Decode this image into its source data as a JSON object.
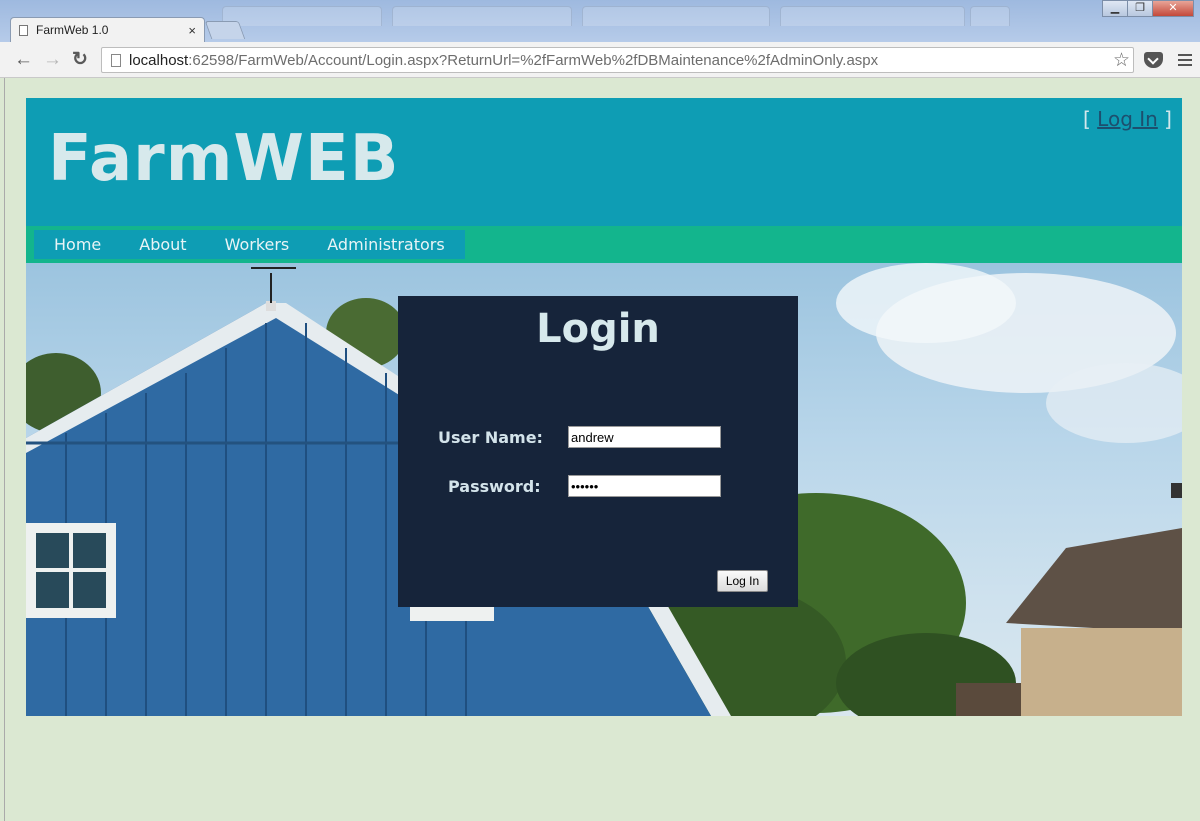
{
  "browser": {
    "tab_title": "FarmWeb 1.0",
    "tab_close": "×",
    "url_host": "localhost",
    "url_rest": ":62598/FarmWeb/Account/Login.aspx?ReturnUrl=%2fFarmWeb%2fDBMaintenance%2fAdminOnly.aspx",
    "nav": {
      "back": "←",
      "forward": "→",
      "reload": "↻"
    },
    "star": "☆",
    "window_buttons": [
      "▁",
      "❐",
      "✕"
    ]
  },
  "header": {
    "site_title": "FarmWEB",
    "login_open": "[ ",
    "login_link": "Log In",
    "login_close": " ]"
  },
  "nav": {
    "items": [
      "Home",
      "About",
      "Workers",
      "Administrators"
    ]
  },
  "login": {
    "heading": "Login",
    "username_label": "User Name:",
    "username_value": "andrew",
    "password_label": "Password:",
    "password_value": "••••••",
    "submit_label": "Log In"
  },
  "colors": {
    "header_bg": "#0e9db4",
    "menu_bar_bg": "#13b58d",
    "panel_bg": "#16243a",
    "page_bg": "#dbe8d2"
  }
}
